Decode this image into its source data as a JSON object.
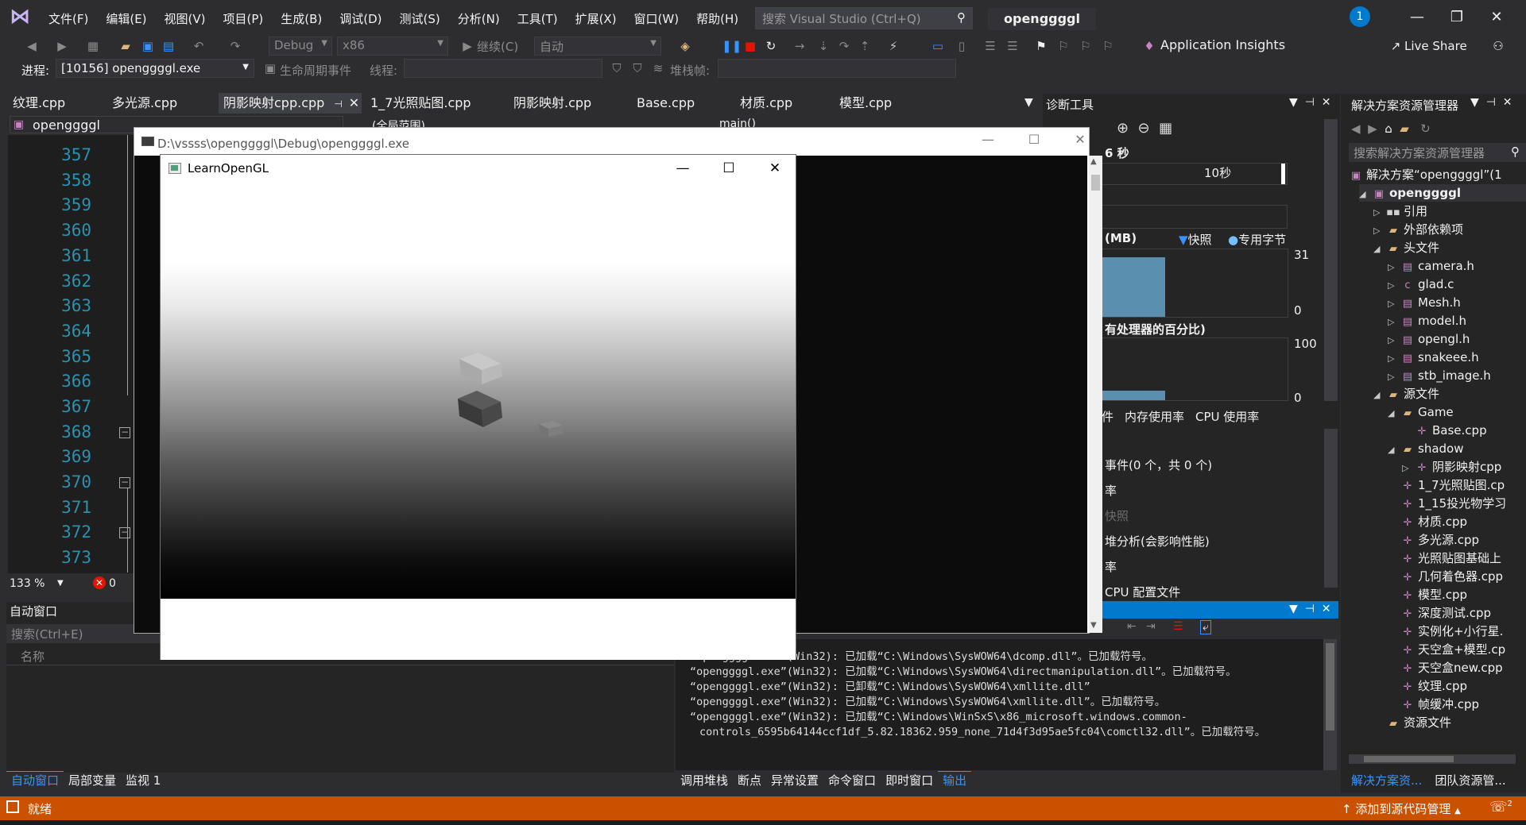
{
  "menu": [
    "文件(F)",
    "编辑(E)",
    "视图(V)",
    "项目(P)",
    "生成(B)",
    "调试(D)",
    "测试(S)",
    "分析(N)",
    "工具(T)",
    "扩展(X)",
    "窗口(W)",
    "帮助(H)"
  ],
  "search": {
    "placeholder": "搜索 Visual Studio (Ctrl+Q)"
  },
  "project_name": "openggggl",
  "notification_count": "1",
  "toolbar": {
    "config": "Debug",
    "platform": "x86",
    "continue": "继续(C)",
    "auto": "自动",
    "app_insights": "Application Insights",
    "live_share": "Live Share"
  },
  "toolbar2": {
    "process_label": "进程:",
    "process_value": "[10156] openggggl.exe",
    "lifecycle": "生命周期事件",
    "thread_label": "线程:",
    "stack_label": "堆栈帧:"
  },
  "editor_tabs": [
    "纹理.cpp",
    "多光源.cpp",
    "阴影映射cpp.cpp",
    "1_7光照贴图.cpp",
    "阴影映射.cpp",
    "Base.cpp",
    "材质.cpp",
    "模型.cpp"
  ],
  "editor": {
    "nav_project": "openggggl",
    "nav_scope": "(全局范围)",
    "nav_func": "main()",
    "line_numbers": [
      "357",
      "358",
      "359",
      "360",
      "361",
      "362",
      "363",
      "364",
      "365",
      "366",
      "367",
      "368",
      "369",
      "370",
      "371",
      "372",
      "373"
    ],
    "zoom": "133 %",
    "errors": "0"
  },
  "console_window": {
    "title": "D:\\vssss\\openggggl\\Debug\\openggggl.exe"
  },
  "gl_window": {
    "title": "LearnOpenGL"
  },
  "auto_window": {
    "title": "自动窗口",
    "search_placeholder": "搜索(Ctrl+E)",
    "column_name": "名称",
    "tabs": [
      "自动窗口",
      "局部变量",
      "监视 1"
    ]
  },
  "diagnostics": {
    "title": "诊断工具",
    "session_time": "6 秒",
    "tick_10s": "10秒",
    "memory_title": "(MB)",
    "snapshot_legend": "快照",
    "private_bytes_legend": "专用字节",
    "memory_max": "31",
    "memory_min": "0",
    "cpu_title": "有处理器的百分比)",
    "cpu_max": "100",
    "cpu_min": "0",
    "tabs": [
      "件",
      "内存使用率",
      "CPU 使用率"
    ],
    "rows": [
      "事件(0 个，共 0 个)",
      "率",
      "快照",
      "堆分析(会影响性能)",
      "率",
      "CPU 配置文件"
    ]
  },
  "output": {
    "lines": [
      "“openggggl.exe”(Win32): 已加载“C:\\Windows\\SysWOW64\\dcomp.dll”。已加载符号。",
      "“openggggl.exe”(Win32): 已加载“C:\\Windows\\SysWOW64\\directmanipulation.dll”。已加载符号。",
      "“openggggl.exe”(Win32): 已卸载“C:\\Windows\\SysWOW64\\xmllite.dll”",
      "“openggggl.exe”(Win32): 已加载“C:\\Windows\\SysWOW64\\xmllite.dll”。已加载符号。",
      "“openggggl.exe”(Win32): 已加载“C:\\Windows\\WinSxS\\x86_microsoft.windows.common-",
      "controls_6595b64144ccf1df_5.82.18362.959_none_71d4f3d95ae5fc04\\comctl32.dll”。已加载符号。"
    ],
    "tabs": [
      "调用堆栈",
      "断点",
      "异常设置",
      "命令窗口",
      "即时窗口",
      "输出"
    ]
  },
  "solution_explorer": {
    "title": "解决方案资源管理器",
    "search_placeholder": "搜索解决方案资源管理器",
    "solution": "解决方案“openggggl”(1",
    "project": "openggggl",
    "items": [
      {
        "label": "引用",
        "icon": "ref",
        "level": 1,
        "arrow": "▷"
      },
      {
        "label": "外部依赖项",
        "icon": "folder",
        "level": 1,
        "arrow": "▷"
      },
      {
        "label": "头文件",
        "icon": "folder",
        "level": 1,
        "arrow": "◢"
      },
      {
        "label": "camera.h",
        "icon": "h",
        "level": 2,
        "arrow": "▷"
      },
      {
        "label": "glad.c",
        "icon": "c",
        "level": 2,
        "arrow": "▷"
      },
      {
        "label": "Mesh.h",
        "icon": "h",
        "level": 2,
        "arrow": "▷"
      },
      {
        "label": "model.h",
        "icon": "h",
        "level": 2,
        "arrow": "▷"
      },
      {
        "label": "opengl.h",
        "icon": "h",
        "level": 2,
        "arrow": "▷"
      },
      {
        "label": "snakeee.h",
        "icon": "h",
        "level": 2,
        "arrow": "▷"
      },
      {
        "label": "stb_image.h",
        "icon": "h",
        "level": 2,
        "arrow": "▷"
      },
      {
        "label": "源文件",
        "icon": "folder",
        "level": 1,
        "arrow": "◢"
      },
      {
        "label": "Game",
        "icon": "folder",
        "level": 2,
        "arrow": "◢"
      },
      {
        "label": "Base.cpp",
        "icon": "cpp",
        "level": 3,
        "arrow": ""
      },
      {
        "label": "shadow",
        "icon": "folder",
        "level": 2,
        "arrow": "◢"
      },
      {
        "label": "阴影映射cpp",
        "icon": "cpp",
        "level": 3,
        "arrow": "▷"
      },
      {
        "label": "1_7光照贴图.cp",
        "icon": "cpp",
        "level": 2,
        "arrow": ""
      },
      {
        "label": "1_15投光物学习",
        "icon": "cpp",
        "level": 2,
        "arrow": ""
      },
      {
        "label": "材质.cpp",
        "icon": "cpp",
        "level": 2,
        "arrow": ""
      },
      {
        "label": "多光源.cpp",
        "icon": "cpp",
        "level": 2,
        "arrow": ""
      },
      {
        "label": "光照贴图基础上",
        "icon": "cpp",
        "level": 2,
        "arrow": ""
      },
      {
        "label": "几何着色器.cpp",
        "icon": "cpp",
        "level": 2,
        "arrow": ""
      },
      {
        "label": "模型.cpp",
        "icon": "cpp",
        "level": 2,
        "arrow": ""
      },
      {
        "label": "深度测试.cpp",
        "icon": "cpp",
        "level": 2,
        "arrow": ""
      },
      {
        "label": "实例化+小行星.",
        "icon": "cpp",
        "level": 2,
        "arrow": ""
      },
      {
        "label": "天空盒+模型.cp",
        "icon": "cpp",
        "level": 2,
        "arrow": ""
      },
      {
        "label": "天空盒new.cpp",
        "icon": "cpp",
        "level": 2,
        "arrow": ""
      },
      {
        "label": "纹理.cpp",
        "icon": "cpp",
        "level": 2,
        "arrow": ""
      },
      {
        "label": "帧缓冲.cpp",
        "icon": "cpp",
        "level": 2,
        "arrow": ""
      },
      {
        "label": "资源文件",
        "icon": "folder",
        "level": 1,
        "arrow": ""
      }
    ],
    "tabs": [
      "解决方案资...",
      "团队资源管..."
    ]
  },
  "status": {
    "ready": "就绪",
    "source_control": "添加到源代码管理",
    "notifications": "2"
  },
  "colors": {
    "accent": "#007acc",
    "status_bar": "#ca5100",
    "background": "#2d2d30"
  }
}
